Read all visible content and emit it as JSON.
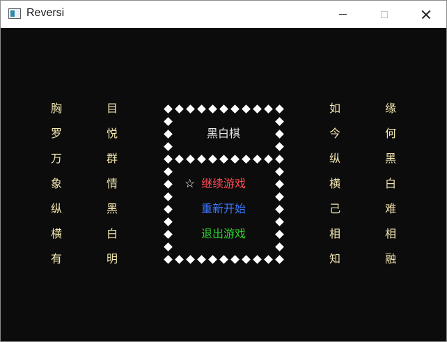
{
  "window": {
    "title": "Reversi",
    "controls": [
      "minimize",
      "maximize",
      "close"
    ],
    "colors": {
      "background": "#0c0c0c",
      "border": "#ffffff",
      "poem": "#f2e6ae"
    }
  },
  "poems": {
    "left": [
      [
        "胸",
        "目"
      ],
      [
        "罗",
        "悦"
      ],
      [
        "万",
        "群"
      ],
      [
        "象",
        "情"
      ],
      [
        "纵",
        "黑"
      ],
      [
        "横",
        "白"
      ],
      [
        "有",
        "明"
      ]
    ],
    "right": [
      [
        "如",
        "缘"
      ],
      [
        "今",
        "何"
      ],
      [
        "纵",
        "黑"
      ],
      [
        "横",
        "白"
      ],
      [
        "己",
        "难"
      ],
      [
        "相",
        "相"
      ],
      [
        "知",
        "融"
      ]
    ]
  },
  "menu": {
    "game_title": "黑白棋",
    "cursor": "☆",
    "items": [
      {
        "label": "继续游戏",
        "color": "#ff4b55"
      },
      {
        "label": "重新开始",
        "color": "#3b78ff"
      },
      {
        "label": "退出游戏",
        "color": "#2fd12f"
      }
    ]
  }
}
